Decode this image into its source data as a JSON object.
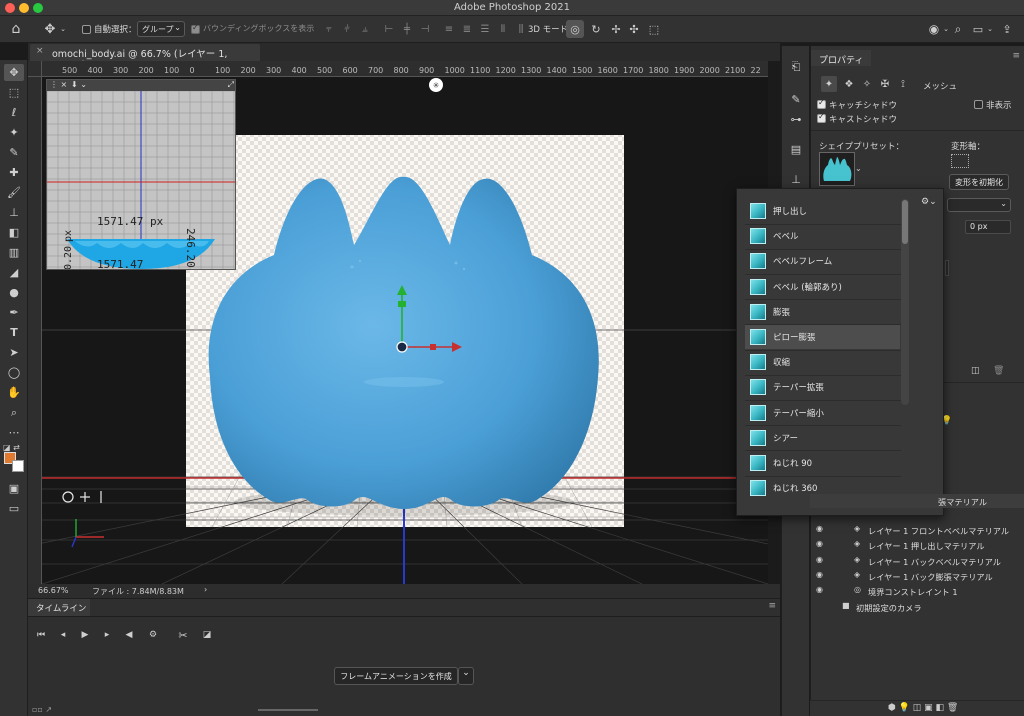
{
  "window": {
    "title": "Adobe Photoshop 2021"
  },
  "options_bar": {
    "auto_select_label": "自動選択：",
    "auto_select_value": "グループ",
    "bounding_box_label": "バウンディングボックスを表示",
    "mode_3d_label": "3D モード："
  },
  "document": {
    "tab_title": "omochi_body.ai @ 66.7% (レイヤー 1, RGB/8) *"
  },
  "ruler": {
    "ticks": [
      "500",
      "400",
      "300",
      "200",
      "100",
      "0",
      "100",
      "200",
      "300",
      "400",
      "500",
      "600",
      "700",
      "800",
      "900",
      "1000",
      "1100",
      "1200",
      "1300",
      "1400",
      "1500",
      "1600",
      "1700",
      "1800",
      "1900",
      "2000",
      "2100",
      "22"
    ]
  },
  "secondary_view": {
    "measure_width": "1571.47 px",
    "measure_width_bottom": "1571.47",
    "measure_height": "246.20",
    "measure_left": "px",
    "measure_left_num": "0.20"
  },
  "status": {
    "zoom": "66.67%",
    "file_info": "ファイル : 7.84M/8.83M",
    "arrow": "›"
  },
  "timeline": {
    "title": "タイムライン",
    "create_button": "フレームアニメーションを作成"
  },
  "properties": {
    "title": "プロパティ",
    "mesh_label": "メッシュ",
    "catch_shadow": "キャッチシャドウ",
    "cast_shadow": "キャストシャドウ",
    "hide_label": "非表示",
    "shape_preset_label": "シェイププリセット：",
    "deform_axis_label": "変形軸：",
    "reset_deform_button": "変形を初期化",
    "value_px": "0 px"
  },
  "shape_presets": [
    "押し出し",
    "ベベル",
    "ベベルフレーム",
    "ベベル (輪郭あり)",
    "膨張",
    "ピロー膨張",
    "収縮",
    "テーパー拡張",
    "テーパー縮小",
    "シアー",
    "ねじれ 90",
    "ねじれ 360"
  ],
  "selected_preset_index": 5,
  "layers": {
    "partial_label": "張マテリアル",
    "rows": [
      "レイヤー 1 フロントベベルマテリアル",
      "レイヤー 1 押し出しマテリアル",
      "レイヤー 1 バックベベルマテリアル",
      "レイヤー 1 バック膨張マテリアル",
      "境界コンストレイント 1",
      "初期設定のカメラ"
    ]
  },
  "colors": {
    "foreground": "#e07a2e",
    "object": "#4a9fd6",
    "accent": "#e04040"
  }
}
